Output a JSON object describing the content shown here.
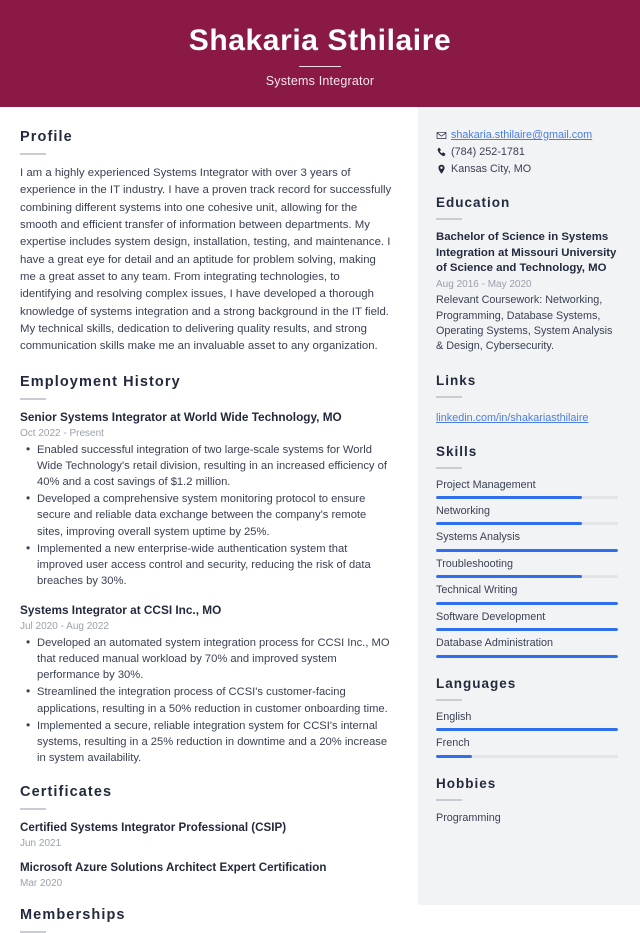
{
  "header": {
    "name": "Shakaria Sthilaire",
    "job_title": "Systems Integrator",
    "background_color": "#8a1a45"
  },
  "theme": {
    "accent_bar_color": "#2f6fed",
    "link_color": "#4a7dde",
    "sidebar_background": "#f2f3f5",
    "heading_color": "#232a3d"
  },
  "main": {
    "profile": {
      "heading": "Profile",
      "text": "I am a highly experienced Systems Integrator with over 3 years of experience in the IT industry. I have a proven track record for successfully combining different systems into one cohesive unit, allowing for the smooth and efficient transfer of information between departments. My expertise includes system design, installation, testing, and maintenance. I have a great eye for detail and an aptitude for problem solving, making me a great asset to any team. From integrating technologies, to identifying and resolving complex issues, I have developed a thorough knowledge of systems integration and a strong background in the IT field. My technical skills, dedication to delivering quality results, and strong communication skills make me an invaluable asset to any organization."
    },
    "employment": {
      "heading": "Employment History",
      "jobs": [
        {
          "title": "Senior Systems Integrator at World Wide Technology, MO",
          "date": "Oct 2022 - Present",
          "bullets": [
            "Enabled successful integration of two large-scale systems for World Wide Technology's retail division, resulting in an increased efficiency of 40% and a cost savings of $1.2 million.",
            "Developed a comprehensive system monitoring protocol to ensure secure and reliable data exchange between the company's remote sites, improving overall system uptime by 25%.",
            "Implemented a new enterprise-wide authentication system that improved user access control and security, reducing the risk of data breaches by 30%."
          ]
        },
        {
          "title": "Systems Integrator at CCSI Inc., MO",
          "date": "Jul 2020 - Aug 2022",
          "bullets": [
            "Developed an automated system integration process for CCSI Inc., MO that reduced manual workload by 70% and improved system performance by 30%.",
            "Streamlined the integration process of CCSI's customer-facing applications, resulting in a 50% reduction in customer onboarding time.",
            "Implemented a secure, reliable integration system for CCSI's internal systems, resulting in a 25% reduction in downtime and a 20% increase in system availability."
          ]
        }
      ]
    },
    "certificates": {
      "heading": "Certificates",
      "items": [
        {
          "name": "Certified Systems Integrator Professional (CSIP)",
          "date": "Jun 2021"
        },
        {
          "name": "Microsoft Azure Solutions Architect Expert Certification",
          "date": "Mar 2020"
        }
      ]
    },
    "memberships": {
      "heading": "Memberships"
    }
  },
  "sidebar": {
    "contact": [
      {
        "icon": "envelope-icon",
        "value": "shakaria.sthilaire@gmail.com",
        "is_link": true
      },
      {
        "icon": "phone-icon",
        "value": "(784) 252-1781",
        "is_link": false
      },
      {
        "icon": "location-pin-icon",
        "value": "Kansas City, MO",
        "is_link": false
      }
    ],
    "education": {
      "heading": "Education",
      "degree": "Bachelor of Science in Systems Integration at Missouri University of Science and Technology, MO",
      "date": "Aug 2016 - May 2020",
      "description": "Relevant Coursework: Networking, Programming, Database Systems, Operating Systems, System Analysis & Design, Cybersecurity."
    },
    "links": {
      "heading": "Links",
      "items": [
        "linkedin.com/in/shakariasthilaire"
      ]
    },
    "skills": {
      "heading": "Skills",
      "items": [
        {
          "label": "Project Management",
          "level": 80
        },
        {
          "label": "Networking",
          "level": 80
        },
        {
          "label": "Systems Analysis",
          "level": 100
        },
        {
          "label": "Troubleshooting",
          "level": 80
        },
        {
          "label": "Technical Writing",
          "level": 100
        },
        {
          "label": "Software Development",
          "level": 100
        },
        {
          "label": "Database Administration",
          "level": 100
        }
      ]
    },
    "languages": {
      "heading": "Languages",
      "items": [
        {
          "label": "English",
          "level": 100
        },
        {
          "label": "French",
          "level": 20
        }
      ]
    },
    "hobbies": {
      "heading": "Hobbies",
      "items": [
        "Programming"
      ]
    }
  }
}
